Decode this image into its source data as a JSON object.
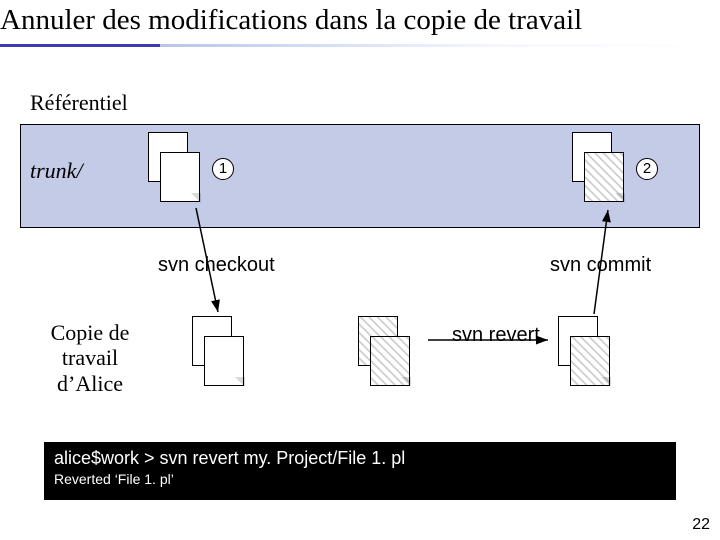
{
  "title": "Annuler des modifications dans la copie de travail",
  "section_label": "Référentiel",
  "trunk_label": "trunk/",
  "revisions": {
    "r1": "1",
    "r2": "2"
  },
  "labels": {
    "checkout": "svn checkout",
    "commit": "svn commit",
    "revert": "svn revert"
  },
  "working_copy_label": "Copie de travail d’Alice",
  "terminal": {
    "command": "alice$work > svn revert my. Project/File 1. pl",
    "response": "Reverted ‘File 1. pl’"
  },
  "page_number": "22"
}
